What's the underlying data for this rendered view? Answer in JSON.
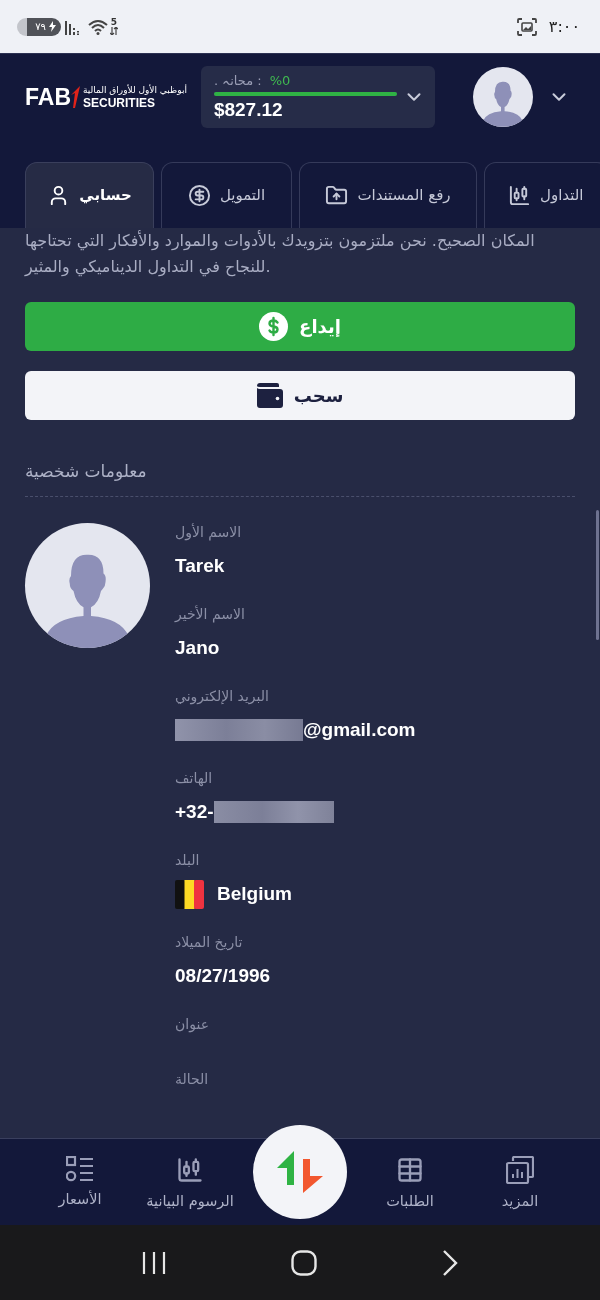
{
  "status_bar": {
    "battery": "٧٩",
    "wifi_badge": "5",
    "time": "٣:٠٠"
  },
  "header": {
    "logo": {
      "mark": "FAB",
      "arabic": "أبوظبي الأول للأوراق المالية",
      "name": "SECURITIES"
    },
    "balance": {
      "label": ". محانہ :",
      "percent": "%0",
      "level": 1,
      "amount": "$827.12"
    }
  },
  "tabs": [
    {
      "label": "التداول",
      "selected": false
    },
    {
      "label": "رفع المستندات",
      "selected": false
    },
    {
      "label": "التمويل",
      "selected": false
    },
    {
      "label": "حسابي",
      "selected": true
    }
  ],
  "intro_text": "المكان الصحيح. نحن ملتزمون بتزويدك بالأدوات والموارد والأفكار التي تحتاجها للنجاح في التداول الديناميكي والمثير.",
  "buttons": [
    {
      "kind": "primary",
      "label": "إيداع"
    },
    {
      "kind": "secondary",
      "label": "سحب"
    }
  ],
  "personal_info": {
    "title": "معلومات شخصية",
    "fields": [
      {
        "label": "الاسم الأول",
        "value": "Tarek"
      },
      {
        "label": "الاسم الأخير",
        "value": "Jano"
      },
      {
        "label": "البريد الإلكتروني",
        "value": "@gmail.com",
        "kind": "email"
      },
      {
        "label": "الهاتف",
        "value": "+32-",
        "kind": "phone"
      },
      {
        "label": "البلد",
        "value": "Belgium",
        "kind": "country"
      },
      {
        "label": "تاريخ الميلاد",
        "value": "08/27/1996"
      },
      {
        "label": "عنوان"
      },
      {
        "label": "الحالة"
      }
    ]
  },
  "bottom_nav": [
    {
      "kind": "tab",
      "label": "المزيد"
    },
    {
      "kind": "tab",
      "label": "الطلبات"
    },
    {
      "kind": "action"
    },
    {
      "kind": "tab",
      "label": "الرسوم البيانية"
    },
    {
      "kind": "tab",
      "label": "الأسعار"
    }
  ]
}
